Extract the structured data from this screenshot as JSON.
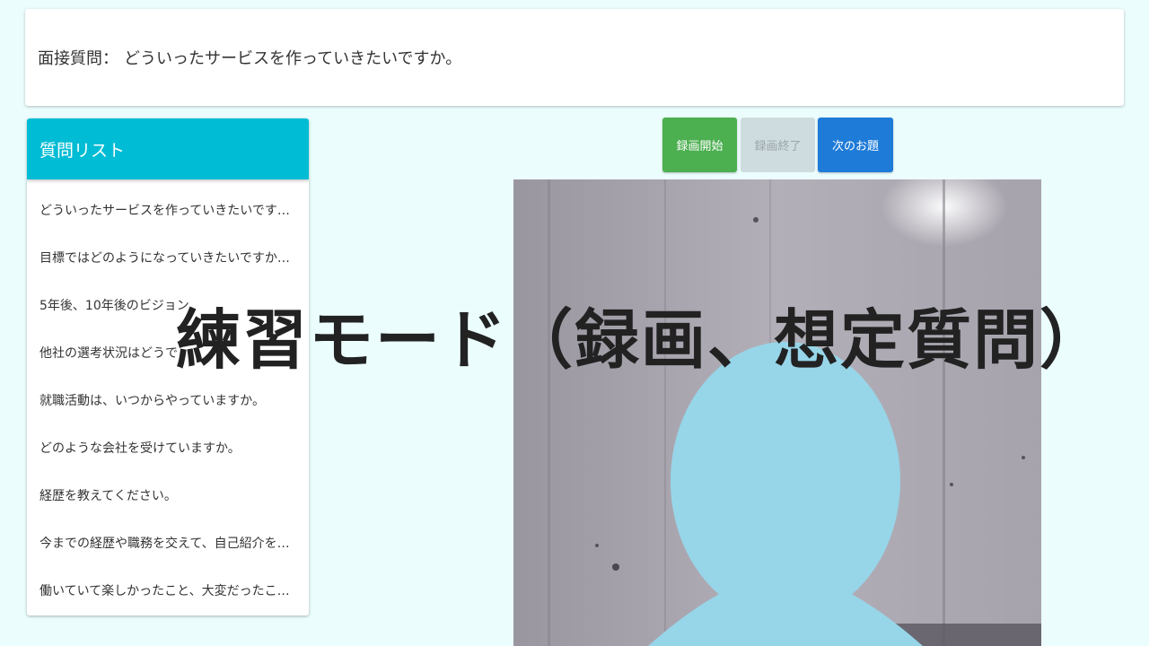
{
  "question": {
    "prefix": "面接質問：",
    "text": "どういったサービスを作っていきたいですか。"
  },
  "sidebar": {
    "title": "質問リスト",
    "items": [
      {
        "label": "どういったサービスを作っていきたいです…"
      },
      {
        "label": "目標ではどのようになっていきたいですか…"
      },
      {
        "label": "5年後、10年後のビジョン"
      },
      {
        "label": "他社の選考状況はどうで"
      },
      {
        "label": "就職活動は、いつからやっていますか。"
      },
      {
        "label": "どのような会社を受けていますか。"
      },
      {
        "label": "経歴を教えてください。"
      },
      {
        "label": "今までの経歴や職務を交えて、自己紹介を…"
      },
      {
        "label": "働いていて楽しかったこと、大変だったこ…"
      }
    ]
  },
  "buttons": {
    "start": "録画開始",
    "stop": "録画終了",
    "next": "次のお題"
  },
  "overlay": {
    "title": "練習モード（録画、想定質問）"
  },
  "colors": {
    "background": "#ebfdfd",
    "header_accent": "#00bcd4",
    "start_button": "#4caf50",
    "stop_button_disabled": "#cfdcdf",
    "next_button": "#1e7bd8",
    "avatar": "#97d5e8"
  },
  "icons": {
    "video_avatar": "person-silhouette-icon"
  }
}
